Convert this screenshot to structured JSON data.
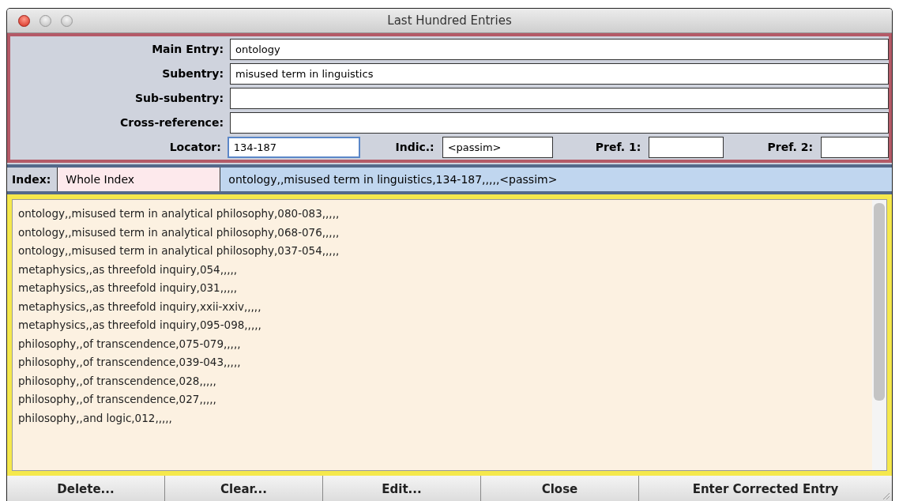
{
  "window": {
    "title": "Last Hundred Entries"
  },
  "form": {
    "fields": [
      {
        "label": "Main Entry:",
        "value": "ontology"
      },
      {
        "label": "Subentry:",
        "value": "misused term in linguistics"
      },
      {
        "label": "Sub-subentry:"
      },
      {
        "label": "Cross-reference:"
      }
    ],
    "locator": {
      "label": "Locator:",
      "value": "134-187",
      "focused": true
    },
    "indic": {
      "label": "Indic.:",
      "value": "<passim>"
    },
    "pref_1": {
      "label": "Pref. 1:"
    },
    "pref_2": {
      "label": "Pref. 2:"
    }
  },
  "index": {
    "label": "Index:",
    "value": "Whole Index",
    "preview": "ontology,,misused term in linguistics,134-187,,,,,<passim>"
  },
  "entries": [
    "ontology,,misused term in analytical philosophy,080-083,,,,,",
    "ontology,,misused term in analytical philosophy,068-076,,,,,",
    "ontology,,misused term in analytical philosophy,037-054,,,,,",
    "metaphysics,,as threefold inquiry,054,,,,,",
    "metaphysics,,as threefold inquiry,031,,,,,",
    "metaphysics,,as threefold inquiry,xxii-xxiv,,,,,",
    "metaphysics,,as threefold inquiry,095-098,,,,,",
    "philosophy,,of transcendence,075-079,,,,,",
    "philosophy,,of transcendence,039-043,,,,,",
    "philosophy,,of transcendence,028,,,,,",
    "philosophy,,of transcendence,027,,,,,",
    "philosophy,,and logic,012,,,,,"
  ],
  "buttons": [
    "Delete...",
    "Clear...",
    "Edit...",
    "Close",
    "Enter Corrected Entry"
  ]
}
